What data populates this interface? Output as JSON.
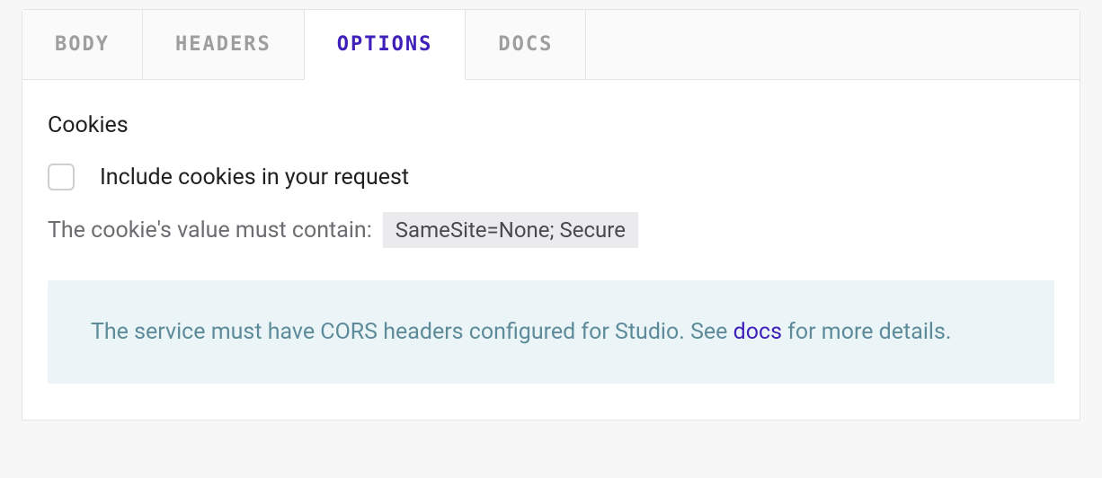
{
  "tabs": {
    "body": "BODY",
    "headers": "HEADERS",
    "options": "OPTIONS",
    "docs": "DOCS"
  },
  "options": {
    "section_title": "Cookies",
    "checkbox_label": "Include cookies in your request",
    "hint_prefix": "The cookie's value must contain:",
    "hint_code": "SameSite=None; Secure",
    "info_text_before": "The service must have CORS headers configured for Studio. See ",
    "info_link": "docs",
    "info_text_after": " for more details."
  }
}
